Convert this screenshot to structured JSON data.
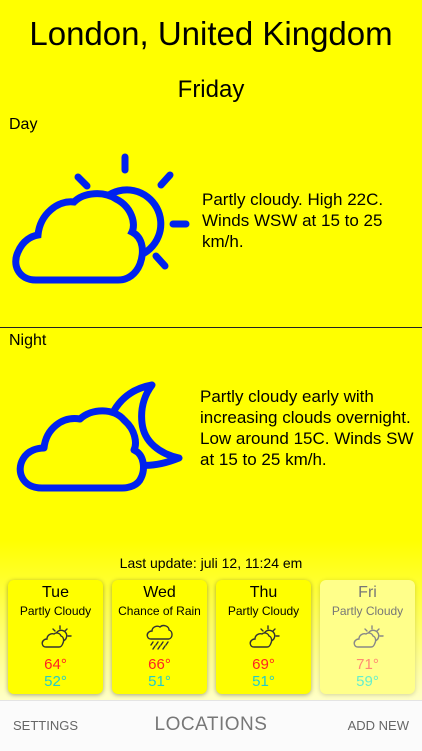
{
  "header": {
    "city": "London, United Kingdom",
    "day": "Friday"
  },
  "day_section": {
    "label": "Day",
    "icon": "partly-cloudy-day-icon",
    "forecast": "Partly cloudy. High 22C. Winds WSW at 15 to 25 km/h."
  },
  "night_section": {
    "label": "Night",
    "icon": "partly-cloudy-night-icon",
    "forecast": "Partly cloudy early with increasing clouds overnight. Low around 15C. Winds SW at 15 to 25 km/h."
  },
  "last_update": "Last update: juli 12, 11:24 em",
  "cards": [
    {
      "day": "Tue",
      "condition": "Partly Cloudy",
      "icon": "partly-cloudy-icon",
      "high": "64°",
      "low": "52°"
    },
    {
      "day": "Wed",
      "condition": "Chance of Rain",
      "icon": "rain-cloud-icon",
      "high": "66°",
      "low": "51°"
    },
    {
      "day": "Thu",
      "condition": "Partly Cloudy",
      "icon": "partly-cloudy-icon",
      "high": "69°",
      "low": "51°"
    },
    {
      "day": "Fri",
      "condition": "Partly Cloudy",
      "icon": "partly-cloudy-icon",
      "high": "71°",
      "low": "59°"
    }
  ],
  "tabbar": {
    "settings": "SETTINGS",
    "locations": "LOCATIONS",
    "add_new": "ADD NEW"
  },
  "colors": {
    "background": "#ffff00",
    "icon_blue": "#0022ee",
    "high_temp": "#ff2222",
    "low_temp": "#22cccc"
  }
}
